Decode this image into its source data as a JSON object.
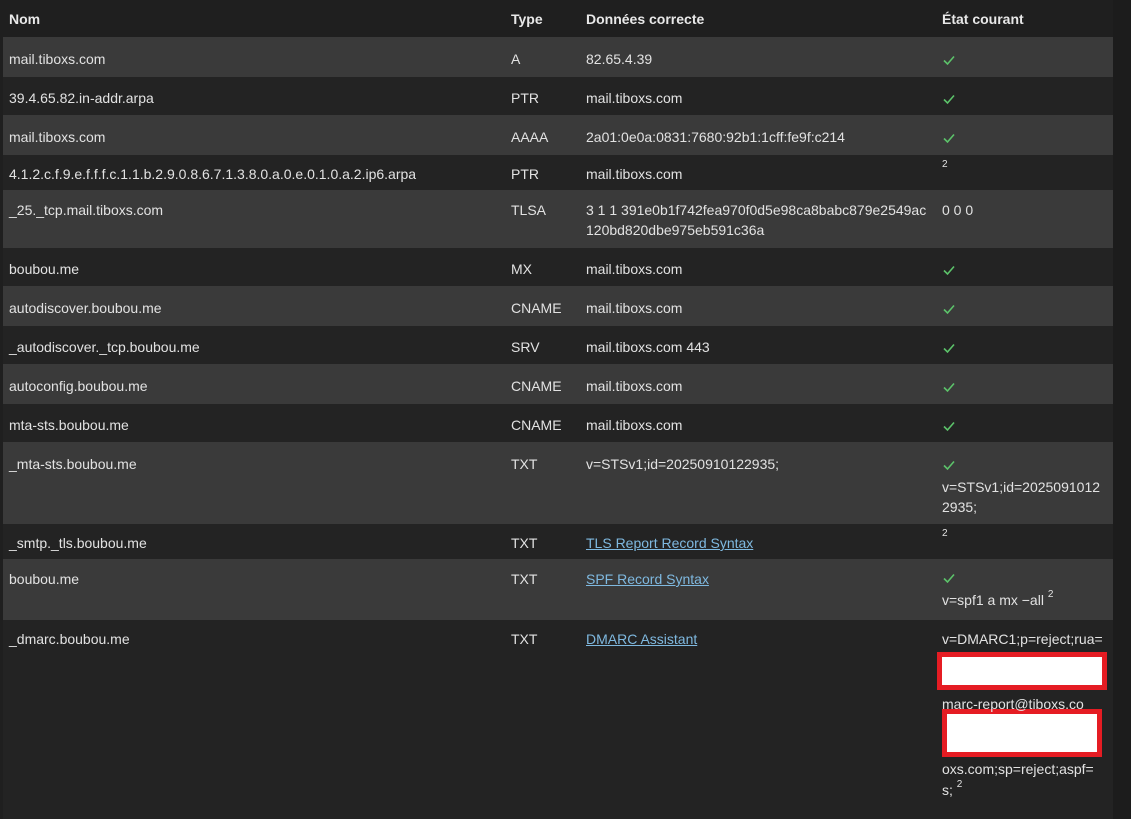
{
  "headers": {
    "nom": "Nom",
    "type": "Type",
    "donnees": "Données correcte",
    "etat": "État courant"
  },
  "colors": {
    "check": "#5cc36a",
    "link": "#7fb9e0",
    "redaction": "#e51c23"
  },
  "rows": [
    {
      "nom": "mail.tiboxs.com",
      "type": "A",
      "data": "82.65.4.39",
      "status": "check"
    },
    {
      "nom": "39.4.65.82.in-addr.arpa",
      "type": "PTR",
      "data": "mail.tiboxs.com",
      "status": "check"
    },
    {
      "nom": "mail.tiboxs.com",
      "type": "AAAA",
      "data": "2a01:0e0a:0831:7680:92b1:1cff:fe9f:c214",
      "status": "check"
    },
    {
      "nom": "4.1.2.c.f.9.e.f.f.f.c.1.1.b.2.9.0.8.6.7.1.3.8.0.a.0.e.0.1.0.a.2.ip6.arpa",
      "type": "PTR",
      "data": "mail.tiboxs.com",
      "status_note": "2"
    },
    {
      "nom": "_25._tcp.mail.tiboxs.com",
      "type": "TLSA",
      "data": "3 1 1 391e0b1f742fea970f0d5e98ca8babc879e2549ac120bd820dbe975eb591c36a",
      "status_text": "0 0 0"
    },
    {
      "nom": "boubou.me",
      "type": "MX",
      "data": "mail.tiboxs.com",
      "status": "check"
    },
    {
      "nom": "autodiscover.boubou.me",
      "type": "CNAME",
      "data": "mail.tiboxs.com",
      "status": "check"
    },
    {
      "nom": "_autodiscover._tcp.boubou.me",
      "type": "SRV",
      "data": "mail.tiboxs.com 443",
      "status": "check"
    },
    {
      "nom": "autoconfig.boubou.me",
      "type": "CNAME",
      "data": "mail.tiboxs.com",
      "status": "check"
    },
    {
      "nom": "mta-sts.boubou.me",
      "type": "CNAME",
      "data": "mail.tiboxs.com",
      "status": "check"
    },
    {
      "nom": "_mta-sts.boubou.me",
      "type": "TXT",
      "data": "v=STSv1;id=20250910122935;",
      "status": "check",
      "status_text": "v=STSv1;id=20250910122935;"
    },
    {
      "nom": "_smtp._tls.boubou.me",
      "type": "TXT",
      "data_link": "TLS Report Record Syntax",
      "status_note": "2"
    },
    {
      "nom": "boubou.me",
      "type": "TXT",
      "data_link": "SPF Record Syntax",
      "status": "check",
      "status_text": "v=spf1 a mx −all",
      "status_note": "2"
    },
    {
      "nom": "_dmarc.boubou.me",
      "type": "TXT",
      "data_link": "DMARC Assistant",
      "status_lines": [
        "v=DMARC1;p=reject;rua=",
        "marc-report@tiboxs.co",
        "oxs.com;sp=reject;aspf=",
        "s;"
      ],
      "status_note": "2"
    }
  ]
}
